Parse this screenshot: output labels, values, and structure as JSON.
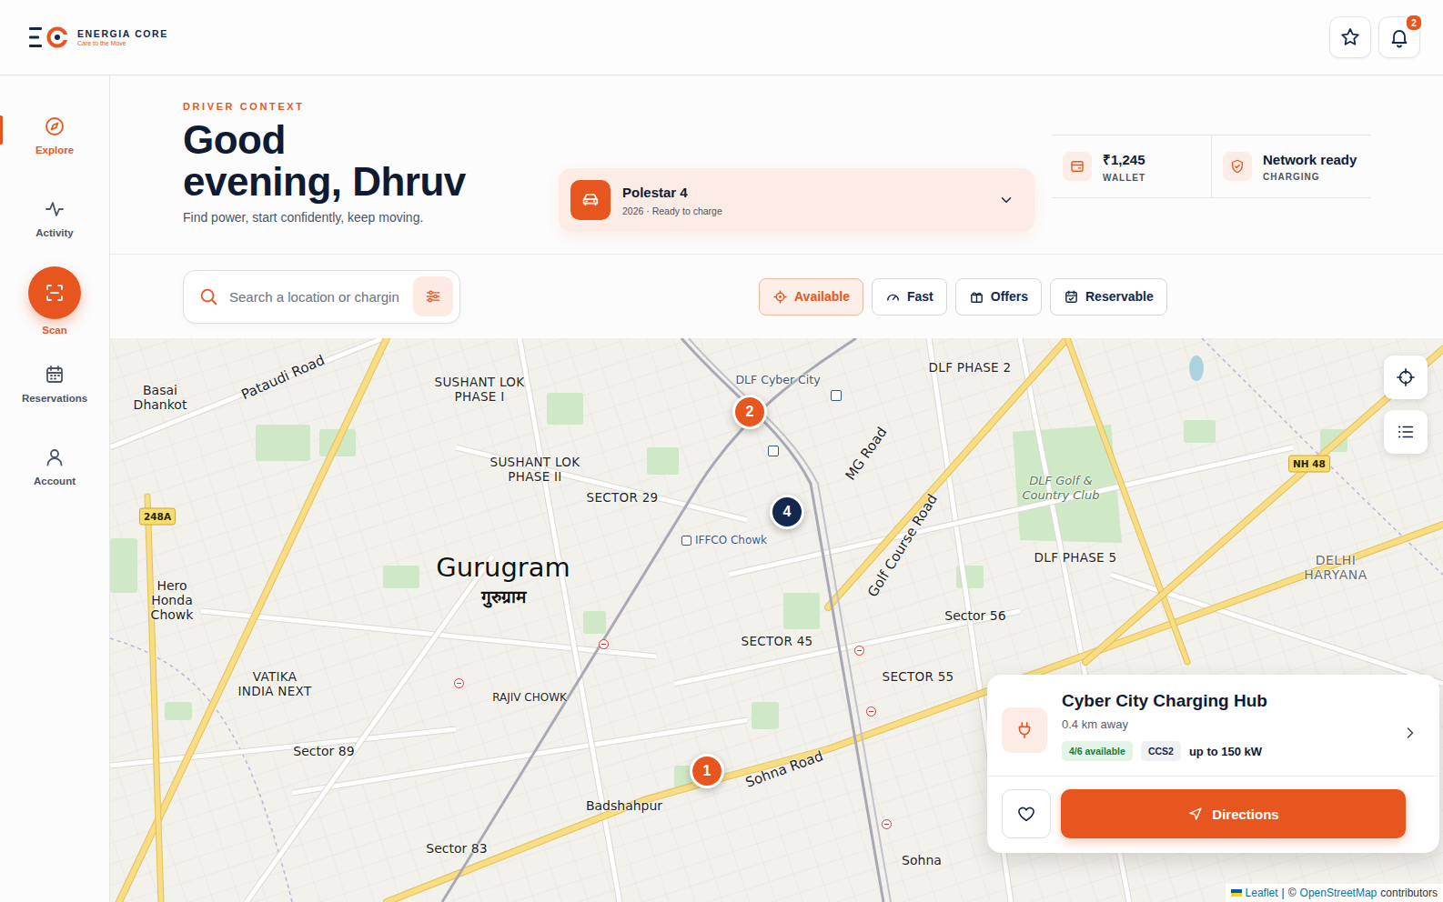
{
  "app": {
    "brand": "ENERGIA CORE",
    "tagline": "Care to the Move",
    "notifications": "2"
  },
  "sidebar": {
    "items": [
      {
        "label": "Explore",
        "selected": true,
        "kind": "nav"
      },
      {
        "label": "Activity",
        "selected": false,
        "kind": "nav"
      },
      {
        "label": "Scan",
        "selected": false,
        "kind": "action"
      },
      {
        "label": "Reservations",
        "selected": false,
        "kind": "nav"
      },
      {
        "label": "Account",
        "selected": false,
        "kind": "nav"
      }
    ]
  },
  "hero": {
    "eyebrow": "DRIVER CONTEXT",
    "greeting_lines": [
      "Good",
      "evening, Dhruv"
    ],
    "subtitle": "Find power, start confidently, keep moving."
  },
  "vehicle": {
    "name": "Polestar 4",
    "detail": "2026 · Ready to charge"
  },
  "stats": [
    {
      "value": "₹1,245",
      "label": "WALLET"
    },
    {
      "value": "Network ready",
      "label": "CHARGING"
    }
  ],
  "search": {
    "placeholder": "Search a location or chargin"
  },
  "filters": [
    {
      "label": "Available",
      "selected": true
    },
    {
      "label": "Fast",
      "selected": false
    },
    {
      "label": "Offers",
      "selected": false
    },
    {
      "label": "Reservable",
      "selected": false
    }
  ],
  "map": {
    "labels": [
      {
        "text": "Basai Dhankot",
        "kind": "place"
      },
      {
        "text": "Pataudi Road",
        "kind": "road"
      },
      {
        "text": "SUSHANT LOK PHASE I",
        "kind": "district"
      },
      {
        "text": "SUSHANT LOK PHASE II",
        "kind": "district"
      },
      {
        "text": "DLF Cyber City",
        "kind": "poi"
      },
      {
        "text": "DLF PHASE 2",
        "kind": "district"
      },
      {
        "text": "SECTOR 29",
        "kind": "district"
      },
      {
        "text": "MG Road",
        "kind": "road"
      },
      {
        "text": "Golf Course Road",
        "kind": "road"
      },
      {
        "text": "DLF Golf & Country Club",
        "kind": "park"
      },
      {
        "text": "NH 48",
        "kind": "badge"
      },
      {
        "text": "248A",
        "kind": "badge"
      },
      {
        "text": "Hero Honda Chowk",
        "kind": "place"
      },
      {
        "text": "Gurugram",
        "kind": "city"
      },
      {
        "text": "गुरुग्राम",
        "kind": "city-local"
      },
      {
        "text": "IFFCO Chowk",
        "kind": "transit"
      },
      {
        "text": "SECTOR 45",
        "kind": "district"
      },
      {
        "text": "DLF PHASE 5",
        "kind": "district"
      },
      {
        "text": "Sector 56",
        "kind": "place"
      },
      {
        "text": "DELHI HARYANA",
        "kind": "region"
      },
      {
        "text": "VATIKA INDIA NEXT",
        "kind": "district"
      },
      {
        "text": "RAJIV CHOWK",
        "kind": "district-small"
      },
      {
        "text": "Sector 89",
        "kind": "place"
      },
      {
        "text": "Badshahpur",
        "kind": "place"
      },
      {
        "text": "Sohna Road",
        "kind": "road"
      },
      {
        "text": "SECTOR 55",
        "kind": "district"
      },
      {
        "text": "Sector 83",
        "kind": "place"
      },
      {
        "text": "Sohna",
        "kind": "place"
      }
    ],
    "pins": [
      {
        "label": "1",
        "color": "#e8561f"
      },
      {
        "label": "2",
        "color": "#e8561f"
      },
      {
        "label": "4",
        "color": "#13284c"
      }
    ],
    "attribution": {
      "leaflet": "Leaflet",
      "separator": "|",
      "copyright": "©",
      "osm": "OpenStreetMap",
      "suffix": "contributors"
    }
  },
  "station": {
    "name": "Cyber City Charging Hub",
    "distance": "0.4 km away",
    "availability": "4/6 available",
    "connector": "CCS2",
    "power": "up to 150 kW",
    "action": "Directions"
  }
}
